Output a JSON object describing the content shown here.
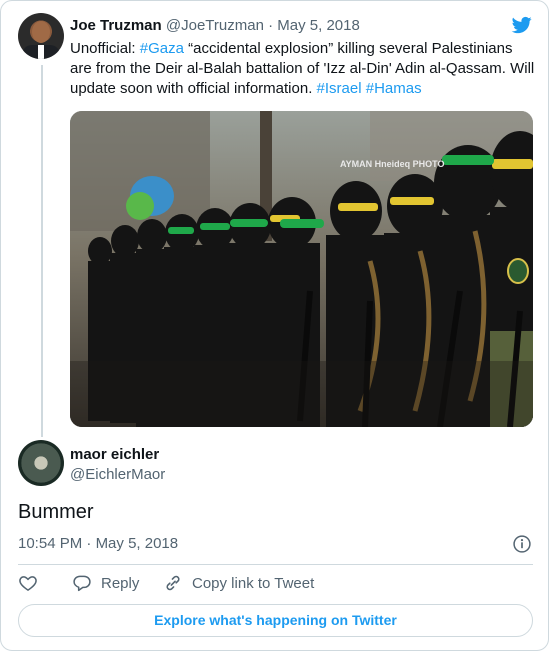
{
  "tweet": {
    "author_name": "Joe Truzman",
    "author_handle": "@JoeTruzman",
    "separator": "·",
    "date": "May 5, 2018",
    "text_parts": [
      "Unofficial: ",
      "#Gaza",
      " “accidental explosion” killing several Palestinians are from the Deir al-Balah battalion of 'Izz al-Din' Adin al-Qassam. Will update soon with official information. ",
      "#Israel",
      " ",
      "#Hamas"
    ],
    "photo_watermark": "AYMAN Hneideq PHOTO"
  },
  "reply": {
    "author_name": "maor eichler",
    "author_handle": "@EichlerMaor",
    "text": "Bummer",
    "time": "10:54 PM",
    "separator": "·",
    "date": "May 5, 2018"
  },
  "actions": {
    "like_label": "",
    "reply_label": "Reply",
    "copy_link_label": "Copy link to Tweet"
  },
  "footer": {
    "explore_label": "Explore what's happening on Twitter"
  },
  "icons": {
    "brand": "twitter-bird-icon",
    "like": "heart-icon",
    "reply": "reply-bubble-icon",
    "copy": "link-icon",
    "info": "info-icon"
  },
  "colors": {
    "accent": "#1d9bf0",
    "text": "#0f1419",
    "muted": "#536471",
    "border": "#cfd9de"
  }
}
